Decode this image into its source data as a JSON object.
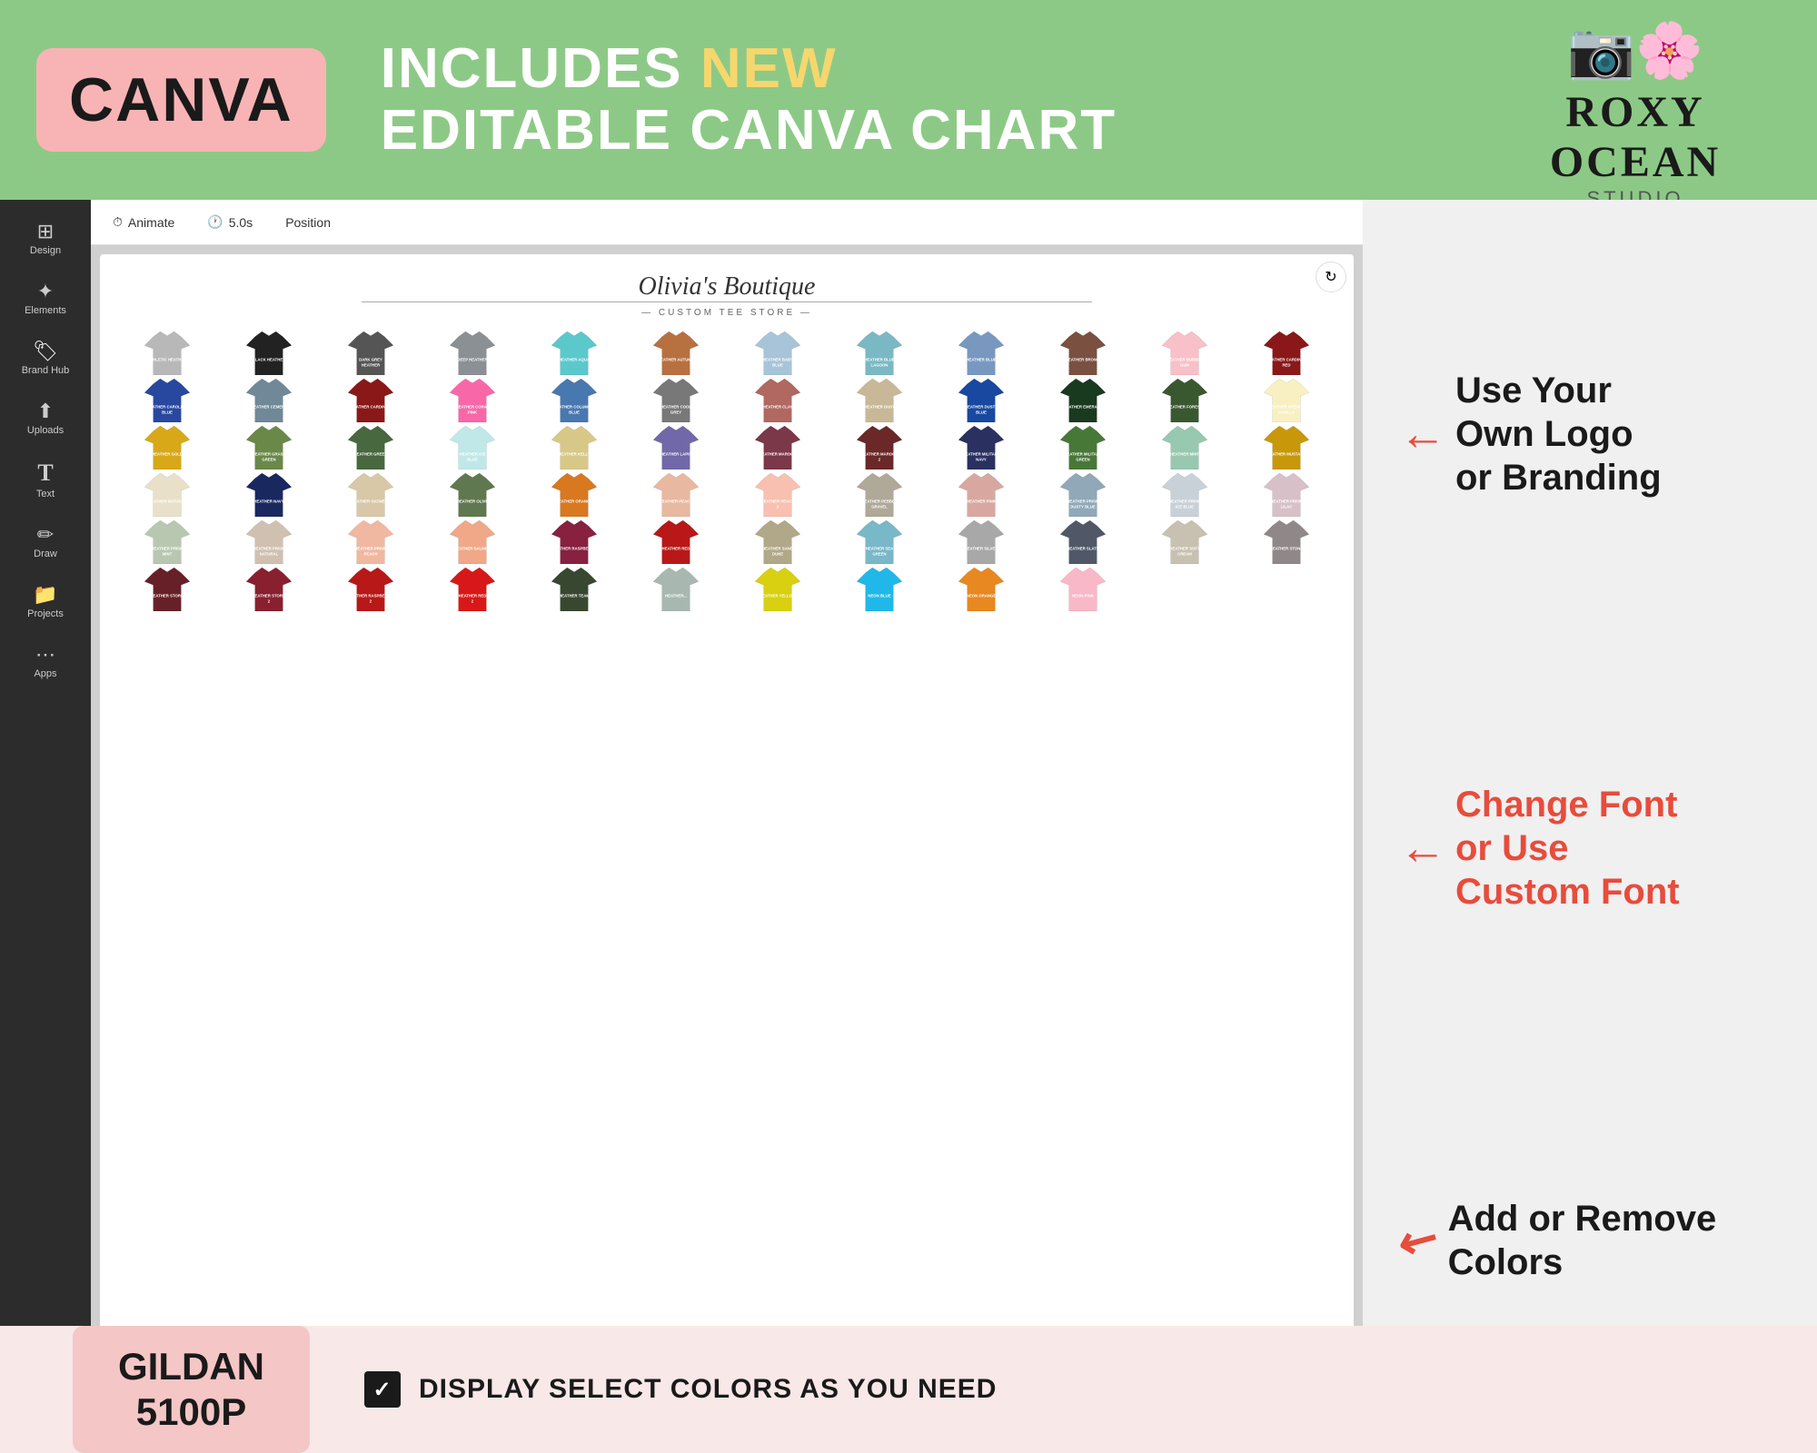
{
  "banner": {
    "canva_label": "CANVA",
    "line1": "INCLUDES ",
    "new_word": "NEW",
    "line2": "EDITABLE CANVA CHART"
  },
  "roxy": {
    "icon": "📷",
    "name": "ROXY OCEAN",
    "studio": "STUDIO"
  },
  "toolbar": {
    "animate": "Animate",
    "time": "5.0s",
    "position": "Position"
  },
  "boutique": {
    "name": "Olivia's Boutique",
    "subtitle": "— CUSTOM TEE STORE —"
  },
  "annotations": {
    "logo_title": "Use Your\nOwn Logo\nor Branding",
    "font_title": "Change Font\nor Use\nCustom Font",
    "colors_title": "Add or Remove\nColors"
  },
  "bottom": {
    "brand": "GILDAN",
    "model": "5100P",
    "display_text": "DISPLAY SELECT COLORS AS YOU NEED"
  },
  "sidebar": {
    "items": [
      {
        "label": "Design",
        "icon": "⊞"
      },
      {
        "label": "Elements",
        "icon": "✦"
      },
      {
        "label": "Brand Hub",
        "icon": "🏷"
      },
      {
        "label": "Uploads",
        "icon": "⬆"
      },
      {
        "label": "Text",
        "icon": "T"
      },
      {
        "label": "Draw",
        "icon": "✏"
      },
      {
        "label": "Projects",
        "icon": "📁"
      },
      {
        "label": "Apps",
        "icon": "⋯"
      }
    ]
  },
  "tshirts": [
    {
      "color": "#b8b8b8",
      "label": "ATHLETIC HEATHER"
    },
    {
      "color": "#222222",
      "label": "BLACK HEATHER"
    },
    {
      "color": "#555555",
      "label": "DARK GREY HEATHER"
    },
    {
      "color": "#8a9094",
      "label": "DEEP HEATHER"
    },
    {
      "color": "#5bc8cc",
      "label": "HEATHER AQUA"
    },
    {
      "color": "#b87040",
      "label": "HEATHER AUTUMN"
    },
    {
      "color": "#a8c4d8",
      "label": "HEATHER BABY BLUE"
    },
    {
      "color": "#7ab8c4",
      "label": "HEATHER BLUE LAGOON"
    },
    {
      "color": "#7898c0",
      "label": "HEATHER BLUE"
    },
    {
      "color": "#7a5040",
      "label": "HEATHER BROWN"
    },
    {
      "color": "#f8c0c8",
      "label": "HEATHER BUBBLE GUM"
    },
    {
      "color": "#8a1818",
      "label": "HEATHER CARDINAL RED"
    },
    {
      "color": "#2848a0",
      "label": "HEATHER CAROLINA BLUE"
    },
    {
      "color": "#708898",
      "label": "HEATHER CEMENT"
    },
    {
      "color": "#8a1818",
      "label": "HEATHER CARDINAL"
    },
    {
      "color": "#f868a8",
      "label": "HEATHER CORAL PINK"
    },
    {
      "color": "#4878b0",
      "label": "HEATHER COLUMBIA BLUE"
    },
    {
      "color": "#787878",
      "label": "HEATHER COOL GREY"
    },
    {
      "color": "#b06860",
      "label": "HEATHER CLAY"
    },
    {
      "color": "#c8b898",
      "label": "HEATHER DUST"
    },
    {
      "color": "#1848a0",
      "label": "HEATHER DUSTY BLUE"
    },
    {
      "color": "#1a3a20",
      "label": "HEATHER EMERALD"
    },
    {
      "color": "#3a5830",
      "label": "HEATHER FOREST"
    },
    {
      "color": "#f8f0c0",
      "label": "HEATHER FRENCH VANILLA"
    },
    {
      "color": "#d8a818",
      "label": "HEATHER GOLD"
    },
    {
      "color": "#6a8848",
      "label": "HEATHER GRASS GREEN"
    },
    {
      "color": "#486840",
      "label": "HEATHER GREEN"
    },
    {
      "color": "#c0e8e8",
      "label": "HEATHER ICE BLUE"
    },
    {
      "color": "#d8c888",
      "label": "HEATHER KELLY"
    },
    {
      "color": "#7068a8",
      "label": "HEATHER LAPIS"
    },
    {
      "color": "#7a3848",
      "label": "HEATHER MAROON"
    },
    {
      "color": "#6a2828",
      "label": "HEATHER MAROON 2"
    },
    {
      "color": "#2a3060",
      "label": "HEATHER MILITARY NAVY"
    },
    {
      "color": "#487838",
      "label": "HEATHER MILITARY GREEN"
    },
    {
      "color": "#98c8b0",
      "label": "HEATHER MINT"
    },
    {
      "color": "#c8980a",
      "label": "HEATHER MUSTARD"
    },
    {
      "color": "#e8e0c8",
      "label": "HEATHER NATURAL"
    },
    {
      "color": "#1a2860",
      "label": "HEATHER NAVY"
    },
    {
      "color": "#d8c8a8",
      "label": "HEATHER OATMEAL"
    },
    {
      "color": "#607850",
      "label": "HEATHER OLIVE"
    },
    {
      "color": "#d87820",
      "label": "HEATHER ORANGE"
    },
    {
      "color": "#e8b8a0",
      "label": "HEATHER PEACH"
    },
    {
      "color": "#f8c0b0",
      "label": "HEATHER PEACH 2"
    },
    {
      "color": "#b0a898",
      "label": "HEATHER PEBBLE GRAVEL"
    },
    {
      "color": "#d8a8a0",
      "label": "HEATHER PINK"
    },
    {
      "color": "#90a8b8",
      "label": "HEATHER PRISM DUSTY BLUE"
    },
    {
      "color": "#c8d0d8",
      "label": "HEATHER PRISM ICE BLUE"
    },
    {
      "color": "#d8c0c8",
      "label": "HEATHER PRISM LILAC"
    },
    {
      "color": "#b8c8b0",
      "label": "HEATHER PRISM MINT"
    },
    {
      "color": "#d0c0b0",
      "label": "HEATHER PRISM NATURAL"
    },
    {
      "color": "#f0b8a0",
      "label": "HEATHER PRISM PEACH"
    },
    {
      "color": "#f0a888",
      "label": "HEATHER SALMON"
    },
    {
      "color": "#882040",
      "label": "HEATHER RASPBERRY"
    },
    {
      "color": "#b81818",
      "label": "HEATHER RED"
    },
    {
      "color": "#b0a888",
      "label": "HEATHER SAND DUNE"
    },
    {
      "color": "#78b8c8",
      "label": "HEATHER SEA GREEN"
    },
    {
      "color": "#a8a8a8",
      "label": "HEATHER SILVER"
    },
    {
      "color": "#505868",
      "label": "HEATHER SLATE"
    },
    {
      "color": "#c8c0b0",
      "label": "HEATHER SOFT CREAM"
    },
    {
      "color": "#908888",
      "label": "HEATHER STONE"
    },
    {
      "color": "#682028",
      "label": "HEATHER STORM"
    },
    {
      "color": "#882030",
      "label": "HEATHER STORM 2"
    },
    {
      "color": "#b81818",
      "label": "HEATHER RASPBERRY 2"
    },
    {
      "color": "#d81818",
      "label": "HEATHER RED 2"
    },
    {
      "color": "#384830",
      "label": "HEATHER TEAM"
    },
    {
      "color": "#a8b8b0",
      "label": "HEATHER..."
    },
    {
      "color": "#d8d010",
      "label": "HEATHER YELLOW"
    },
    {
      "color": "#20b8e8",
      "label": "NEON BLUE"
    },
    {
      "color": "#e88820",
      "label": "NEON ORANGE"
    },
    {
      "color": "#f8b8c8",
      "label": "NEON PINK"
    }
  ]
}
